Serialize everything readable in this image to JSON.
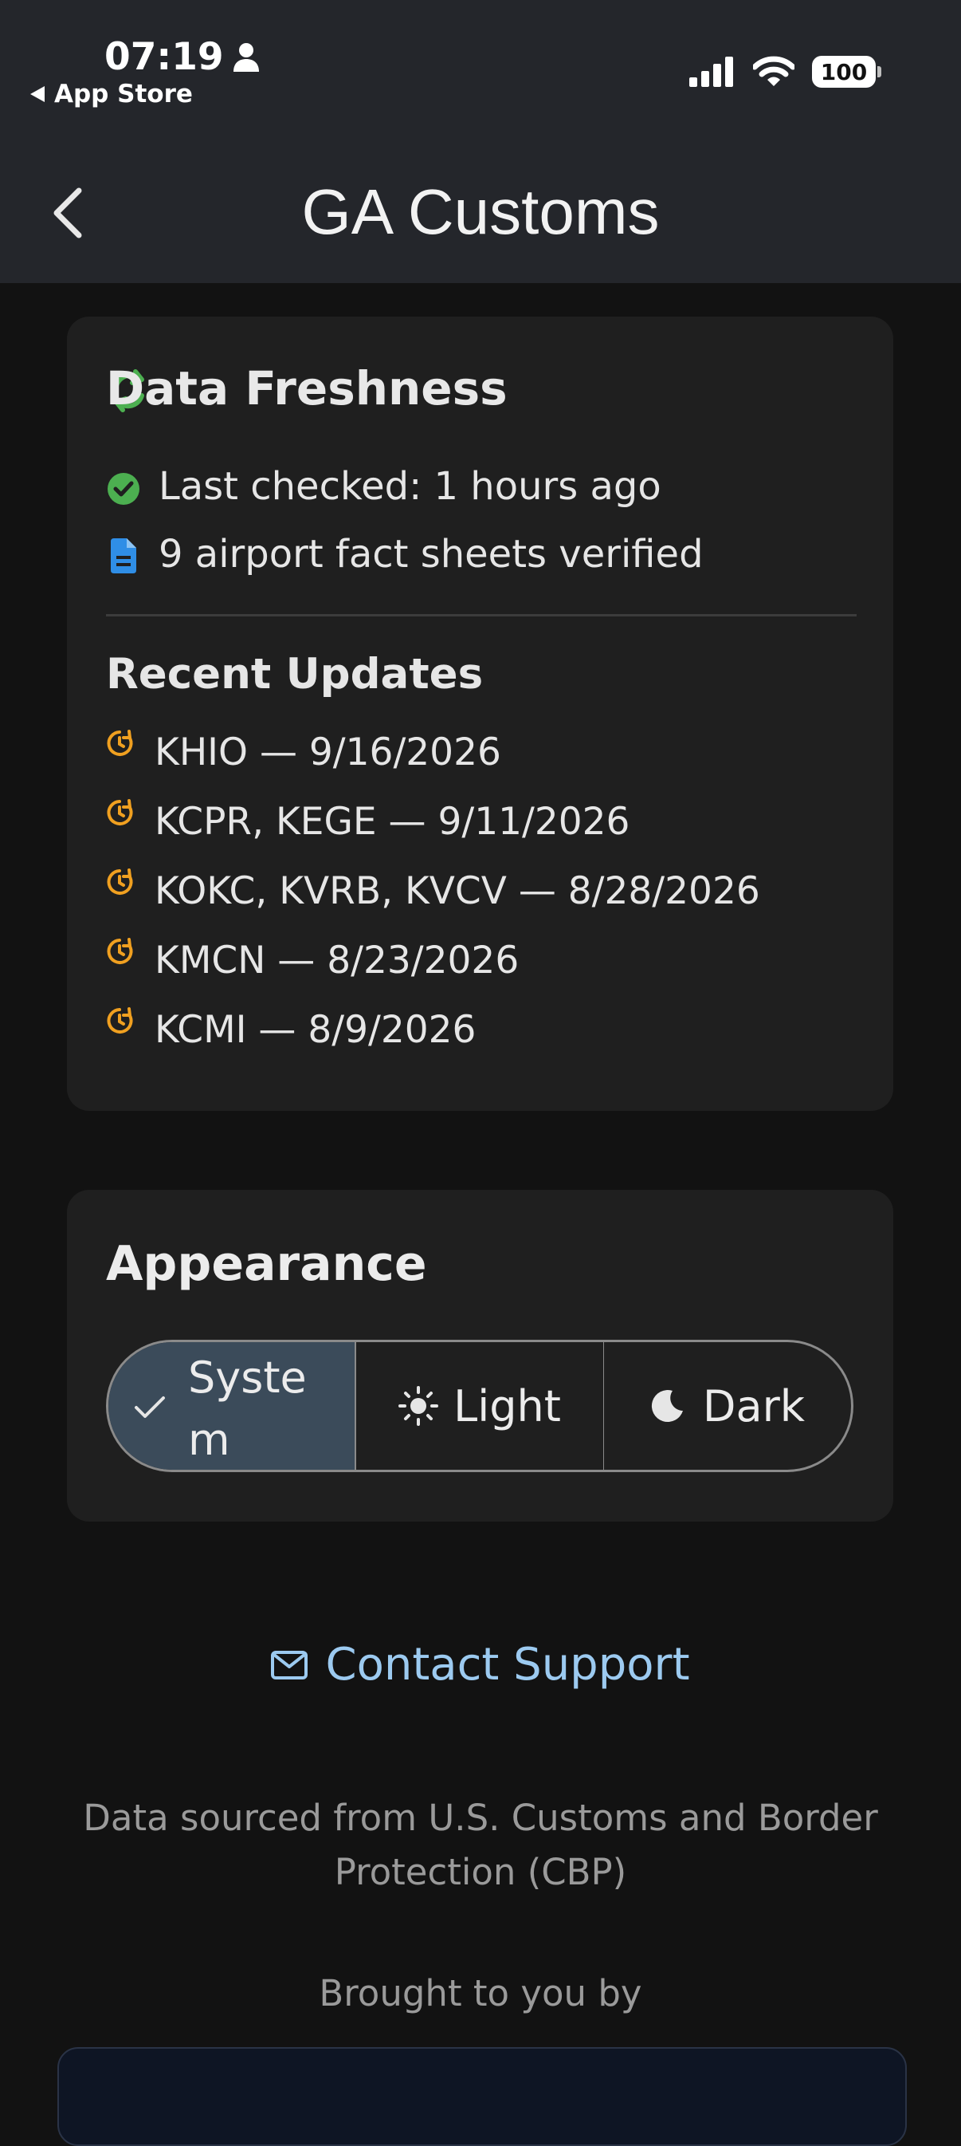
{
  "status_bar": {
    "time": "07:19",
    "back_label": "App Store",
    "battery": "100"
  },
  "header": {
    "title": "GA Customs"
  },
  "data_freshness": {
    "title": "Data Freshness",
    "last_checked": "Last checked: 1 hours ago",
    "verified": "9 airport fact sheets verified",
    "recent_updates_title": "Recent Updates",
    "updates": [
      "KHIO — 9/16/2026",
      "KCPR, KEGE — 9/11/2026",
      "KOKC, KVRB, KVCV — 8/28/2026",
      "KMCN — 8/23/2026",
      "KCMI — 8/9/2026"
    ],
    "colors": {
      "refresh": "#4caf50",
      "check": "#4caf50",
      "doc": "#2f8ee6",
      "update": "#f0a020"
    }
  },
  "appearance": {
    "title": "Appearance",
    "options": {
      "system_line1": "Syste",
      "system_line2": "m",
      "light": "Light",
      "dark": "Dark"
    },
    "selected": "System"
  },
  "contact": {
    "label": "Contact Support"
  },
  "footer": {
    "source_line1": "Data sourced from U.S. Customs and Border",
    "source_line2": "Protection (CBP)",
    "brought_by": "Brought to you by"
  }
}
